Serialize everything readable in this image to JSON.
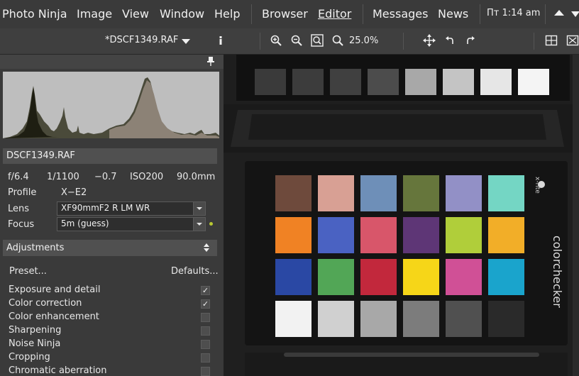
{
  "menubar": {
    "app_name": "Photo Ninja",
    "items": [
      "Image",
      "View",
      "Window",
      "Help"
    ],
    "modes": [
      "Browser",
      "Editor"
    ],
    "extras": [
      "Messages",
      "News"
    ],
    "clock": "Пт 1:14 am"
  },
  "toolbar": {
    "filename": "*DSCF1349.RAF",
    "zoom": "25.0%"
  },
  "histogram": {
    "description_icons": [
      "pin-icon"
    ]
  },
  "file_panel": {
    "name": "DSCF1349.RAF",
    "exif": [
      "f/6.4",
      "1/1100",
      "−0.7",
      "ISO200",
      "90.0mm"
    ],
    "profile_label": "Profile",
    "profile_value": "X−E2",
    "lens_label": "Lens",
    "lens_value": "XF90mmF2 R LM WR",
    "focus_label": "Focus",
    "focus_value": "5m (guess)"
  },
  "adjustments": {
    "title": "Adjustments",
    "preset_label": "Preset...",
    "defaults_label": "Defaults...",
    "items": [
      {
        "label": "Exposure and detail",
        "checked": true
      },
      {
        "label": "Color correction",
        "checked": true
      },
      {
        "label": "Color enhancement",
        "checked": false
      },
      {
        "label": "Sharpening",
        "checked": false
      },
      {
        "label": "Noise Ninja",
        "checked": false
      },
      {
        "label": "Cropping",
        "checked": false
      },
      {
        "label": "Chromatic aberration",
        "checked": false
      }
    ]
  },
  "image": {
    "checker_colors": [
      "#6e4a3c",
      "#d8a094",
      "#6e8fb8",
      "#66763c",
      "#9290c6",
      "#74d6c4",
      "#f08224",
      "#4a62c2",
      "#d8566a",
      "#5e3676",
      "#b0ce3a",
      "#f2ae28",
      "#2a48a4",
      "#52a656",
      "#c2283c",
      "#f6d618",
      "#d05096",
      "#1aa4cc",
      "#f2f2f2",
      "#d0d0d0",
      "#a8a8a8",
      "#7c7c7c",
      "#505050",
      "#2a2a2a"
    ],
    "top_patches": [
      "#3a3a3a",
      "#3c3c3c",
      "#404040",
      "#4c4c4c",
      "#a8a8a8",
      "#c4c4c4",
      "#e6e6e6",
      "#f4f4f4"
    ],
    "brand_text": "colorchecker",
    "logo_text": "x-rite"
  }
}
